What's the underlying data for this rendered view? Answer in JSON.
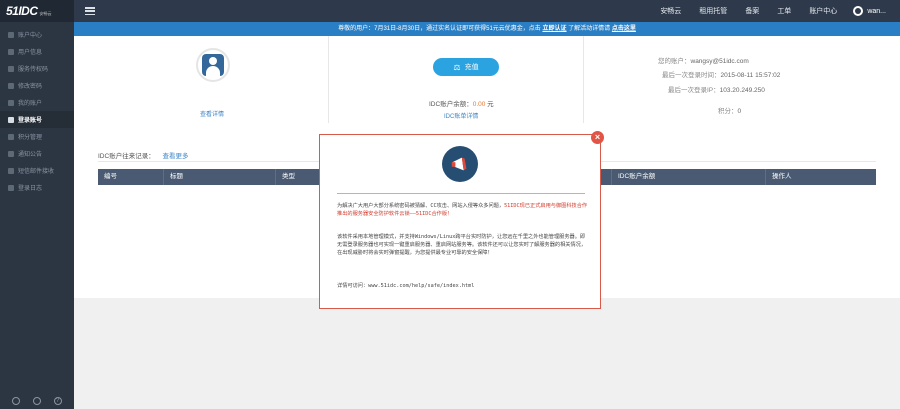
{
  "app": {
    "logo": "51IDC",
    "logo_sub": "安畅云"
  },
  "sidebar": {
    "items": [
      {
        "label": "账户中心",
        "icon": "home-icon",
        "active": false
      },
      {
        "label": "用户信息",
        "icon": "user-icon",
        "active": false
      },
      {
        "label": "服务传权码",
        "icon": "key-icon",
        "active": false
      },
      {
        "label": "修改密码",
        "icon": "lock-icon",
        "active": false
      },
      {
        "label": "我的账户",
        "icon": "wallet-icon",
        "active": false
      },
      {
        "label": "登录账号",
        "icon": "login-icon",
        "active": true
      },
      {
        "label": "积分管理",
        "icon": "points-icon",
        "active": false
      },
      {
        "label": "通知公告",
        "icon": "bell-icon",
        "active": false
      },
      {
        "label": "短信邮件接收",
        "icon": "mail-icon",
        "active": false
      },
      {
        "label": "登录日志",
        "icon": "log-icon",
        "active": false
      }
    ],
    "bottom_icons": [
      "notification-icon",
      "power-icon",
      "help-icon"
    ],
    "help_glyph": "?"
  },
  "topbar": {
    "nav": [
      "安畅云",
      "租用托管",
      "备案",
      "工单",
      "账户中心"
    ],
    "username": "wan..."
  },
  "notice": {
    "text": "尊敬的用户：7月31日-8月30日，通过实名认证即可获得51元云优惠金，点击",
    "link1": "立即认证",
    "mid": "了解活动详情请",
    "link2": "点击这里"
  },
  "profile": {
    "view_detail": "查看详情"
  },
  "wallet": {
    "recharge": "充值",
    "balance_label": "IDC账户余额：",
    "balance_value": "0.00",
    "balance_unit": "元",
    "bill_link": "IDC账单详情"
  },
  "account": {
    "email_label": "您的账户：",
    "email": "wangsy@51idc.com",
    "last_login_time_label": "最后一次登录时间：",
    "last_login_time": "2015-08-11 15:57:02",
    "last_login_ip_label": "最后一次登录IP：",
    "last_login_ip": "103.20.249.250",
    "points_label": "积分：",
    "points": "0"
  },
  "records": {
    "title": "IDC账户往来记录：",
    "more": "查看更多",
    "columns": [
      "编号",
      "标题",
      "类型",
      "",
      "",
      "IDC账户余额",
      "操作人"
    ]
  },
  "modal": {
    "close": "×",
    "p1_a": "为解决广大用户大部分系统密码被猜解、CC攻击、网站入侵等众多问题，",
    "p1_b": "51IDC现已正式启用与御图科技合作推出的服务器安全防护软件云锁——51IDC合作版！",
    "p2": "该软件采用本地管理模式，并支持Windows/Linux跨平台实时防护，让您远在千里之外也能管理服务器。即无需登录服务器也可实现一键重启服务器、重启网站服务等。该软件还可以让您实时了解服务器的相关情况，在出现威胁时将会实时弹窗提醒，为您提供最专业可靠的安全保障！",
    "p3": "详情可访问：www.51idc.com/help/safe/index.html"
  }
}
